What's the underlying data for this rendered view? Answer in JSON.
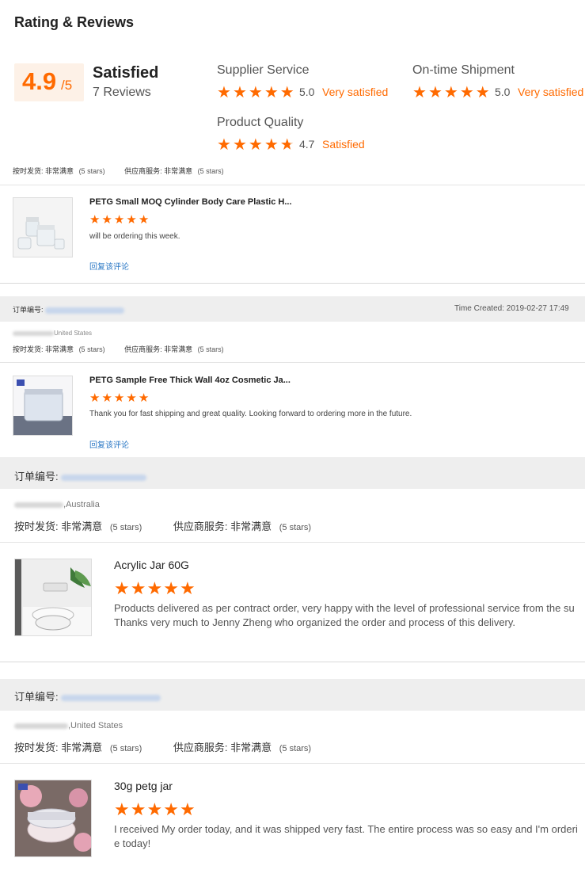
{
  "header": {
    "title": "Rating & Reviews"
  },
  "summary": {
    "score": "4.9",
    "score_suffix": "/5",
    "label": "Satisfied",
    "reviews": "7 Reviews"
  },
  "metrics": [
    {
      "label": "Supplier Service",
      "value": "5.0",
      "text": "Very satisfied",
      "stars": 5
    },
    {
      "label": "On-time Shipment",
      "value": "5.0",
      "text": "Very satisfied",
      "stars": 5
    },
    {
      "label": "Product Quality",
      "value": "4.7",
      "text": "Satisfied",
      "stars": 4.7
    }
  ],
  "reviews": [
    {
      "on_time_label": "按时发货:",
      "on_time_value": "非常满意",
      "on_time_stars": "(5 stars)",
      "service_label": "供应商服务:",
      "service_value": "非常满意",
      "service_stars": "(5 stars)",
      "product_name": "PETG Small MOQ Cylinder Body Care Plastic H...",
      "stars": 5,
      "text": "will be ordering this week.",
      "reply": "回复该评论"
    },
    {
      "order_label": "订单编号:",
      "time_created": "Time Created: 2019-02-27 17:49",
      "buyer_country": "United States",
      "on_time_label": "按时发货:",
      "on_time_value": "非常满意",
      "on_time_stars": "(5 stars)",
      "service_label": "供应商服务:",
      "service_value": "非常满意",
      "service_stars": "(5 stars)",
      "product_name": "PETG Sample Free Thick Wall 4oz Cosmetic Ja...",
      "stars": 5,
      "text": "Thank you for fast shipping and great quality. Looking forward to ordering more in the future.",
      "reply": "回复该评论"
    },
    {
      "order_label": "订单编号:",
      "buyer_country": ",Australia",
      "on_time_label": "按时发货:",
      "on_time_value": "非常满意",
      "on_time_stars": "(5 stars)",
      "service_label": "供应商服务:",
      "service_value": "非常满意",
      "service_stars": "(5 stars)",
      "product_name": "Acrylic Jar 60G",
      "stars": 5,
      "text_line1": "Products delivered as per contract order, very happy with the level of professional service from the su",
      "text_line2": "Thanks very much to Jenny Zheng who organized the order and process of this delivery."
    },
    {
      "order_label": "订单编号:",
      "buyer_country": ",United States",
      "on_time_label": "按时发货:",
      "on_time_value": "非常满意",
      "on_time_stars": "(5 stars)",
      "service_label": "供应商服务:",
      "service_value": "非常满意",
      "service_stars": "(5 stars)",
      "product_name": "30g petg jar",
      "stars": 5,
      "text_line1": "I received My order today, and it was shipped very fast. The entire process was so easy and I'm orderi",
      "text_line2": "e today!"
    }
  ],
  "colors": {
    "accent": "#ff6a00",
    "link": "#2b78c5",
    "band": "#eeeeee"
  },
  "icons": {
    "star": "star-icon",
    "half_star": "half-star-icon"
  }
}
